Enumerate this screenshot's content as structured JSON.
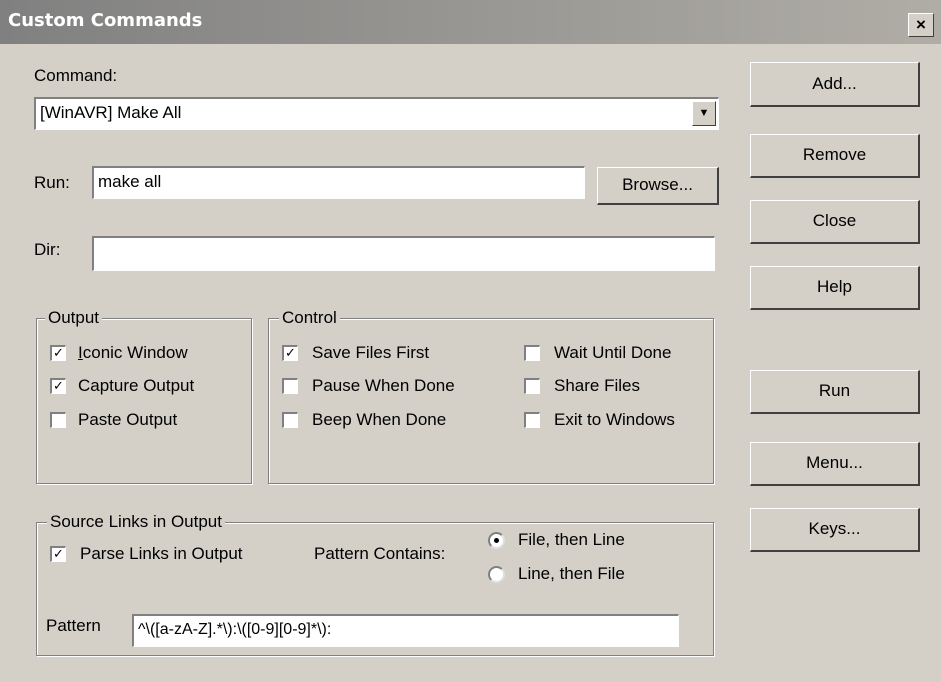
{
  "window": {
    "title": "Custom Commands",
    "close_glyph": "×"
  },
  "command": {
    "label": "Command:",
    "selected": "[WinAVR] Make All",
    "arrow_glyph": "▼"
  },
  "run": {
    "label": "Run:",
    "value": "make all",
    "browse_label": "Browse..."
  },
  "dir": {
    "label": "Dir:",
    "value": ""
  },
  "output": {
    "legend": "Output",
    "items": [
      {
        "label": "Iconic Window",
        "checked": true
      },
      {
        "label": "Capture Output",
        "checked": true
      },
      {
        "label": "Paste Output",
        "checked": false
      }
    ]
  },
  "control": {
    "legend": "Control",
    "items": [
      {
        "label": "Save Files First",
        "checked": true
      },
      {
        "label": "Pause When Done",
        "checked": false
      },
      {
        "label": "Beep When Done",
        "checked": false
      },
      {
        "label": "Wait Until Done",
        "checked": false
      },
      {
        "label": "Share Files",
        "checked": false
      },
      {
        "label": "Exit to Windows",
        "checked": false
      }
    ]
  },
  "source_links": {
    "legend": "Source Links in Output",
    "parse_label": "Parse Links in Output",
    "parse_checked": true,
    "pattern_contains_label": "Pattern Contains:",
    "radio_options": [
      {
        "label": "File, then Line",
        "selected": true
      },
      {
        "label": "Line, then File",
        "selected": false
      }
    ],
    "pattern_label": "Pattern",
    "pattern_value": "^\\([a-zA-Z].*\\):\\([0-9][0-9]*\\):"
  },
  "buttons": {
    "add": "Add...",
    "remove": "Remove",
    "close": "Close",
    "help": "Help",
    "run": "Run",
    "menu": "Menu...",
    "keys": "Keys..."
  },
  "check_glyph": "✓"
}
